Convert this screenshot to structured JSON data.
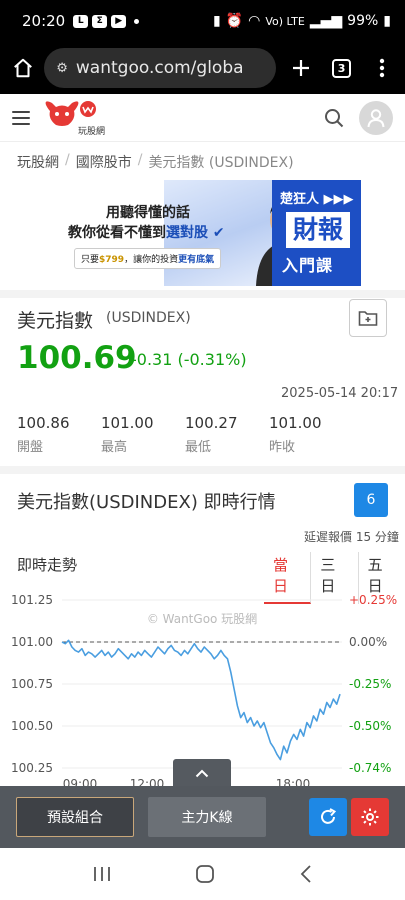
{
  "status_bar": {
    "time": "20:20",
    "icons": [
      "line-app-icon",
      "sigma-app-icon",
      "youtube-icon"
    ],
    "battery": "99%",
    "network": "Vo) LTE"
  },
  "browser": {
    "url": "wantgoo.com/globa",
    "tab_count": "3"
  },
  "site": {
    "logo_text": "玩股網"
  },
  "breadcrumb": {
    "items": [
      "玩股網",
      "國際股市",
      "美元指數 (USDINDEX)"
    ]
  },
  "ad": {
    "line1": "用聽得懂的話",
    "line2_prefix": "教你從看不懂到",
    "line2_highlight": "選對股",
    "line3_prefix": "只要",
    "line3_price": "$799",
    "line3_mid": "，讓你的投資",
    "line3_highlight": "更有底氣",
    "right_title": "楚狂人 ▶▶▶",
    "right_box": "財報",
    "right_bottom": "入門課"
  },
  "quote": {
    "name": "美元指數",
    "code": "(USDINDEX)",
    "price": "100.69",
    "change": "-0.31 (-0.31%)",
    "timestamp": "2025-05-14 20:17",
    "stats": [
      {
        "value": "100.86",
        "label": "開盤"
      },
      {
        "value": "101.00",
        "label": "最高"
      },
      {
        "value": "100.27",
        "label": "最低"
      },
      {
        "value": "101.00",
        "label": "昨收"
      }
    ],
    "up_color": "#12a112"
  },
  "realtime": {
    "title": "美元指數(USDINDEX) 即時行情",
    "badge": "6",
    "delay_note": "延遲報價 15 分鐘",
    "trend_title": "即時走勢",
    "tabs": [
      {
        "label": "當日",
        "active": true
      },
      {
        "label": "三日",
        "active": false
      },
      {
        "label": "五日",
        "active": false
      }
    ]
  },
  "chart_data": {
    "type": "line",
    "watermark": "© WantGoo 玩股網",
    "reference_close": 101.0,
    "ylim": [
      100.25,
      101.25
    ],
    "y_ticks_left": [
      "101.25",
      "101.00",
      "100.75",
      "100.50",
      "100.25"
    ],
    "y_ticks_right": [
      "+0.25%",
      "0.00%",
      "-0.25%",
      "-0.50%",
      "-0.74%"
    ],
    "x_ticks": [
      "09:00",
      "12:00",
      "18:00"
    ],
    "series": [
      {
        "color": "#4a9ee0",
        "values": [
          101.0,
          100.99,
          101.01,
          100.97,
          100.95,
          100.94,
          100.96,
          100.92,
          100.94,
          100.93,
          100.91,
          100.93,
          100.95,
          100.92,
          100.94,
          100.91,
          100.93,
          100.96,
          100.94,
          100.92,
          100.9,
          100.93,
          100.91,
          100.94,
          100.92,
          100.95,
          100.93,
          100.91,
          100.94,
          100.97,
          100.95,
          100.93,
          100.96,
          100.98,
          100.95,
          100.94,
          100.92,
          100.95,
          100.93,
          100.96,
          100.99,
          100.96,
          100.94,
          100.97,
          100.95,
          100.93,
          100.9,
          100.92,
          100.95,
          100.92,
          100.9,
          100.82,
          100.72,
          100.62,
          100.55,
          100.58,
          100.52,
          100.55,
          100.5,
          100.53,
          100.49,
          100.52,
          100.46,
          100.4,
          100.37,
          100.33,
          100.3,
          100.38,
          100.34,
          100.41,
          100.45,
          100.42,
          100.48,
          100.44,
          100.52,
          100.49,
          100.56,
          100.53,
          100.6,
          100.57,
          100.64,
          100.61,
          100.66,
          100.63,
          100.69
        ]
      }
    ],
    "colors": {
      "positive": "#e53935",
      "zero": "#555555",
      "negative": "#12a112"
    }
  },
  "bottom_bar": {
    "preset_label": "預設組合",
    "k_label": "主力K線"
  }
}
